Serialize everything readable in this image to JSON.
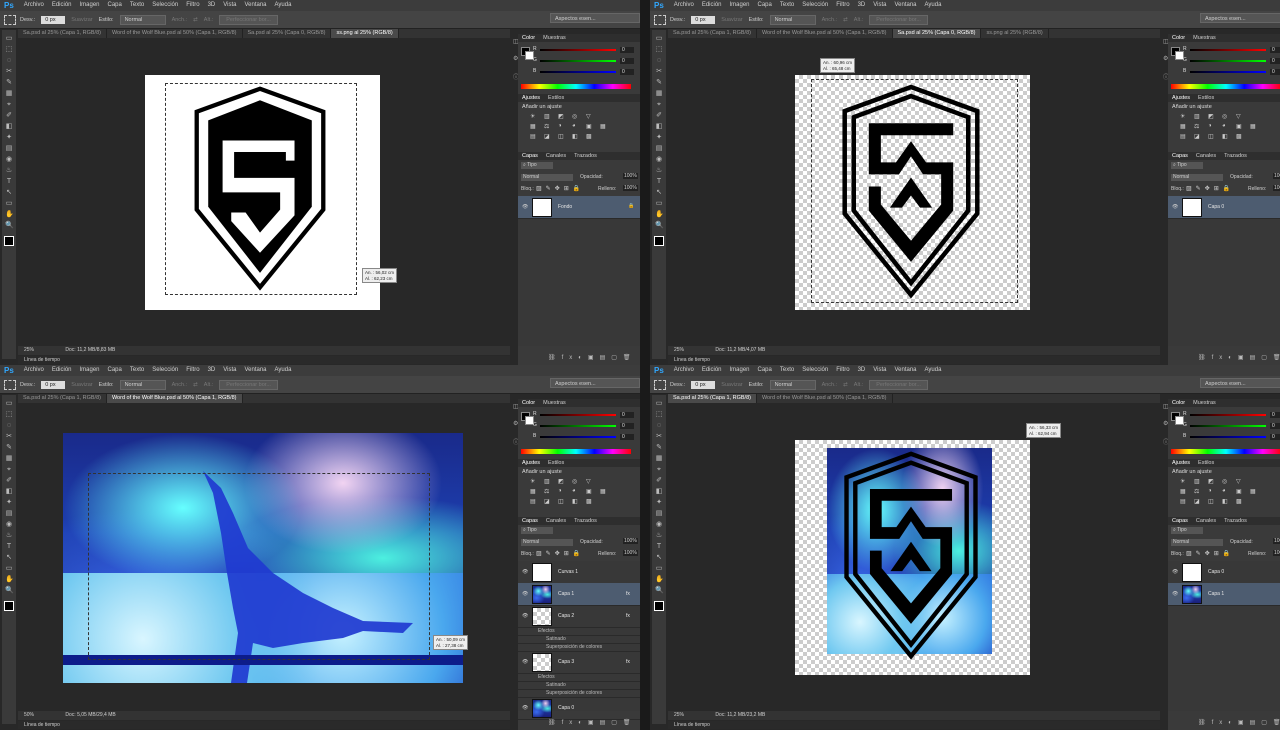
{
  "menu": {
    "ps": "Ps",
    "items": [
      "Archivo",
      "Edición",
      "Imagen",
      "Capa",
      "Texto",
      "Selección",
      "Filtro",
      "3D",
      "Vista",
      "Ventana",
      "Ayuda"
    ]
  },
  "options": {
    "desv_label": "Desv.:",
    "desv_value": "0 px",
    "suavizar": "Suavizar",
    "estilo_label": "Estilo:",
    "estilo_value": "Normal",
    "anch_label": "Anch.:",
    "alt_label": "Alt.:",
    "perfeccionar": "Perfeccionar bor...",
    "workspace": "Aspectos esen..."
  },
  "panels": {
    "color_tab": "Color",
    "muestras_tab": "Muestras",
    "r_label": "R",
    "g_label": "G",
    "b_label": "B",
    "r_value": "0",
    "g_value": "0",
    "b_value": "0",
    "ajustes_tab": "Ajustes",
    "estilos_tab": "Estilos",
    "add_adjust": "Añadir un ajuste",
    "adj_icons": [
      "☀",
      "▥",
      "◩",
      "◎",
      "▽",
      "",
      "▦",
      "⚖",
      "◑",
      "◕",
      "▣",
      "▦",
      "▤",
      "◪",
      "◫",
      "◧",
      "▩"
    ],
    "capas_tab": "Capas",
    "canales_tab": "Canales",
    "trazados_tab": "Trazados",
    "tipo_label": "Tipo",
    "blend": "Normal",
    "opacidad_label": "Opacidad:",
    "relleno_label": "Relleno:",
    "bloq_label": "Bloq.:",
    "hundred": "100%",
    "eye": "👁",
    "fx": "fx"
  },
  "timeline_label": "Línea de tiempo",
  "quads": [
    {
      "tabs": [
        "Sa.psd al 25% (Capa 1, RGB/8)",
        "Word of the Wolf Blue.psd al 50% (Capa 1, RGB/8)",
        "Sa.psd al 25% (Capa 0, RGB/8)",
        "ss.png al 25% (RGB/8)"
      ],
      "active_tab": 3,
      "zoom": "25%",
      "doc": "Doc: 11,2 MB/8,83 MB",
      "tip_an": "An. :   56,02 cm",
      "tip_al": "Al. :   62,23 cm",
      "layers": [
        {
          "name": "Fondo",
          "locked": true
        }
      ]
    },
    {
      "tabs": [
        "Sa.psd al 25% (Capa 1, RGB/8)",
        "Word of the Wolf Blue.psd al 50% (Capa 1, RGB/8)",
        "Sa.psd al 25% (Capa 0, RGB/8)",
        "ss.png al 25% (RGB/8)"
      ],
      "active_tab": 2,
      "zoom": "25%",
      "doc": "Doc: 11,2 MB/4,07 MB",
      "tip_an": "An. :   60,96 cm",
      "tip_al": "Al. :   65,48 cm",
      "layers": [
        {
          "name": "Capa 0"
        }
      ]
    },
    {
      "tabs": [
        "Sa.psd al 25% (Capa 1, RGB/8)",
        "Word of the Wolf Blue.psd al 50% (Capa 1, RGB/8)"
      ],
      "active_tab": 1,
      "zoom": "50%",
      "doc": "Doc: 5,05 MB/29,4 MB",
      "tip_an": "An. :   50,09 cm",
      "tip_al": "Al. :   27,38 cm",
      "layers": [
        {
          "name": "Curvas 1"
        },
        {
          "name": "Capa 1",
          "fx": true
        },
        {
          "name": "Capa 2",
          "fx": true
        },
        {
          "name": "Efectos",
          "sub": true
        },
        {
          "name": "Satinado",
          "sub2": true
        },
        {
          "name": "Superposición de colores",
          "sub2": true
        },
        {
          "name": "Capa 3",
          "fx": true
        },
        {
          "name": "Efectos",
          "sub": true
        },
        {
          "name": "Satinado",
          "sub2": true
        },
        {
          "name": "Superposición de colores",
          "sub2": true
        },
        {
          "name": "Capa 0"
        }
      ]
    },
    {
      "tabs": [
        "Sa.psd al 25% (Capa 1, RGB/8)",
        "Word of the Wolf Blue.psd al 50% (Capa 1, RGB/8)"
      ],
      "active_tab": 0,
      "zoom": "25%",
      "doc": "Doc: 11,2 MB/23,2 MB",
      "tip_an": "An. :   56,33 cm",
      "tip_al": "Al. :   62,94 cm",
      "layers": [
        {
          "name": "Capa 0"
        },
        {
          "name": "Capa 1"
        }
      ]
    }
  ]
}
